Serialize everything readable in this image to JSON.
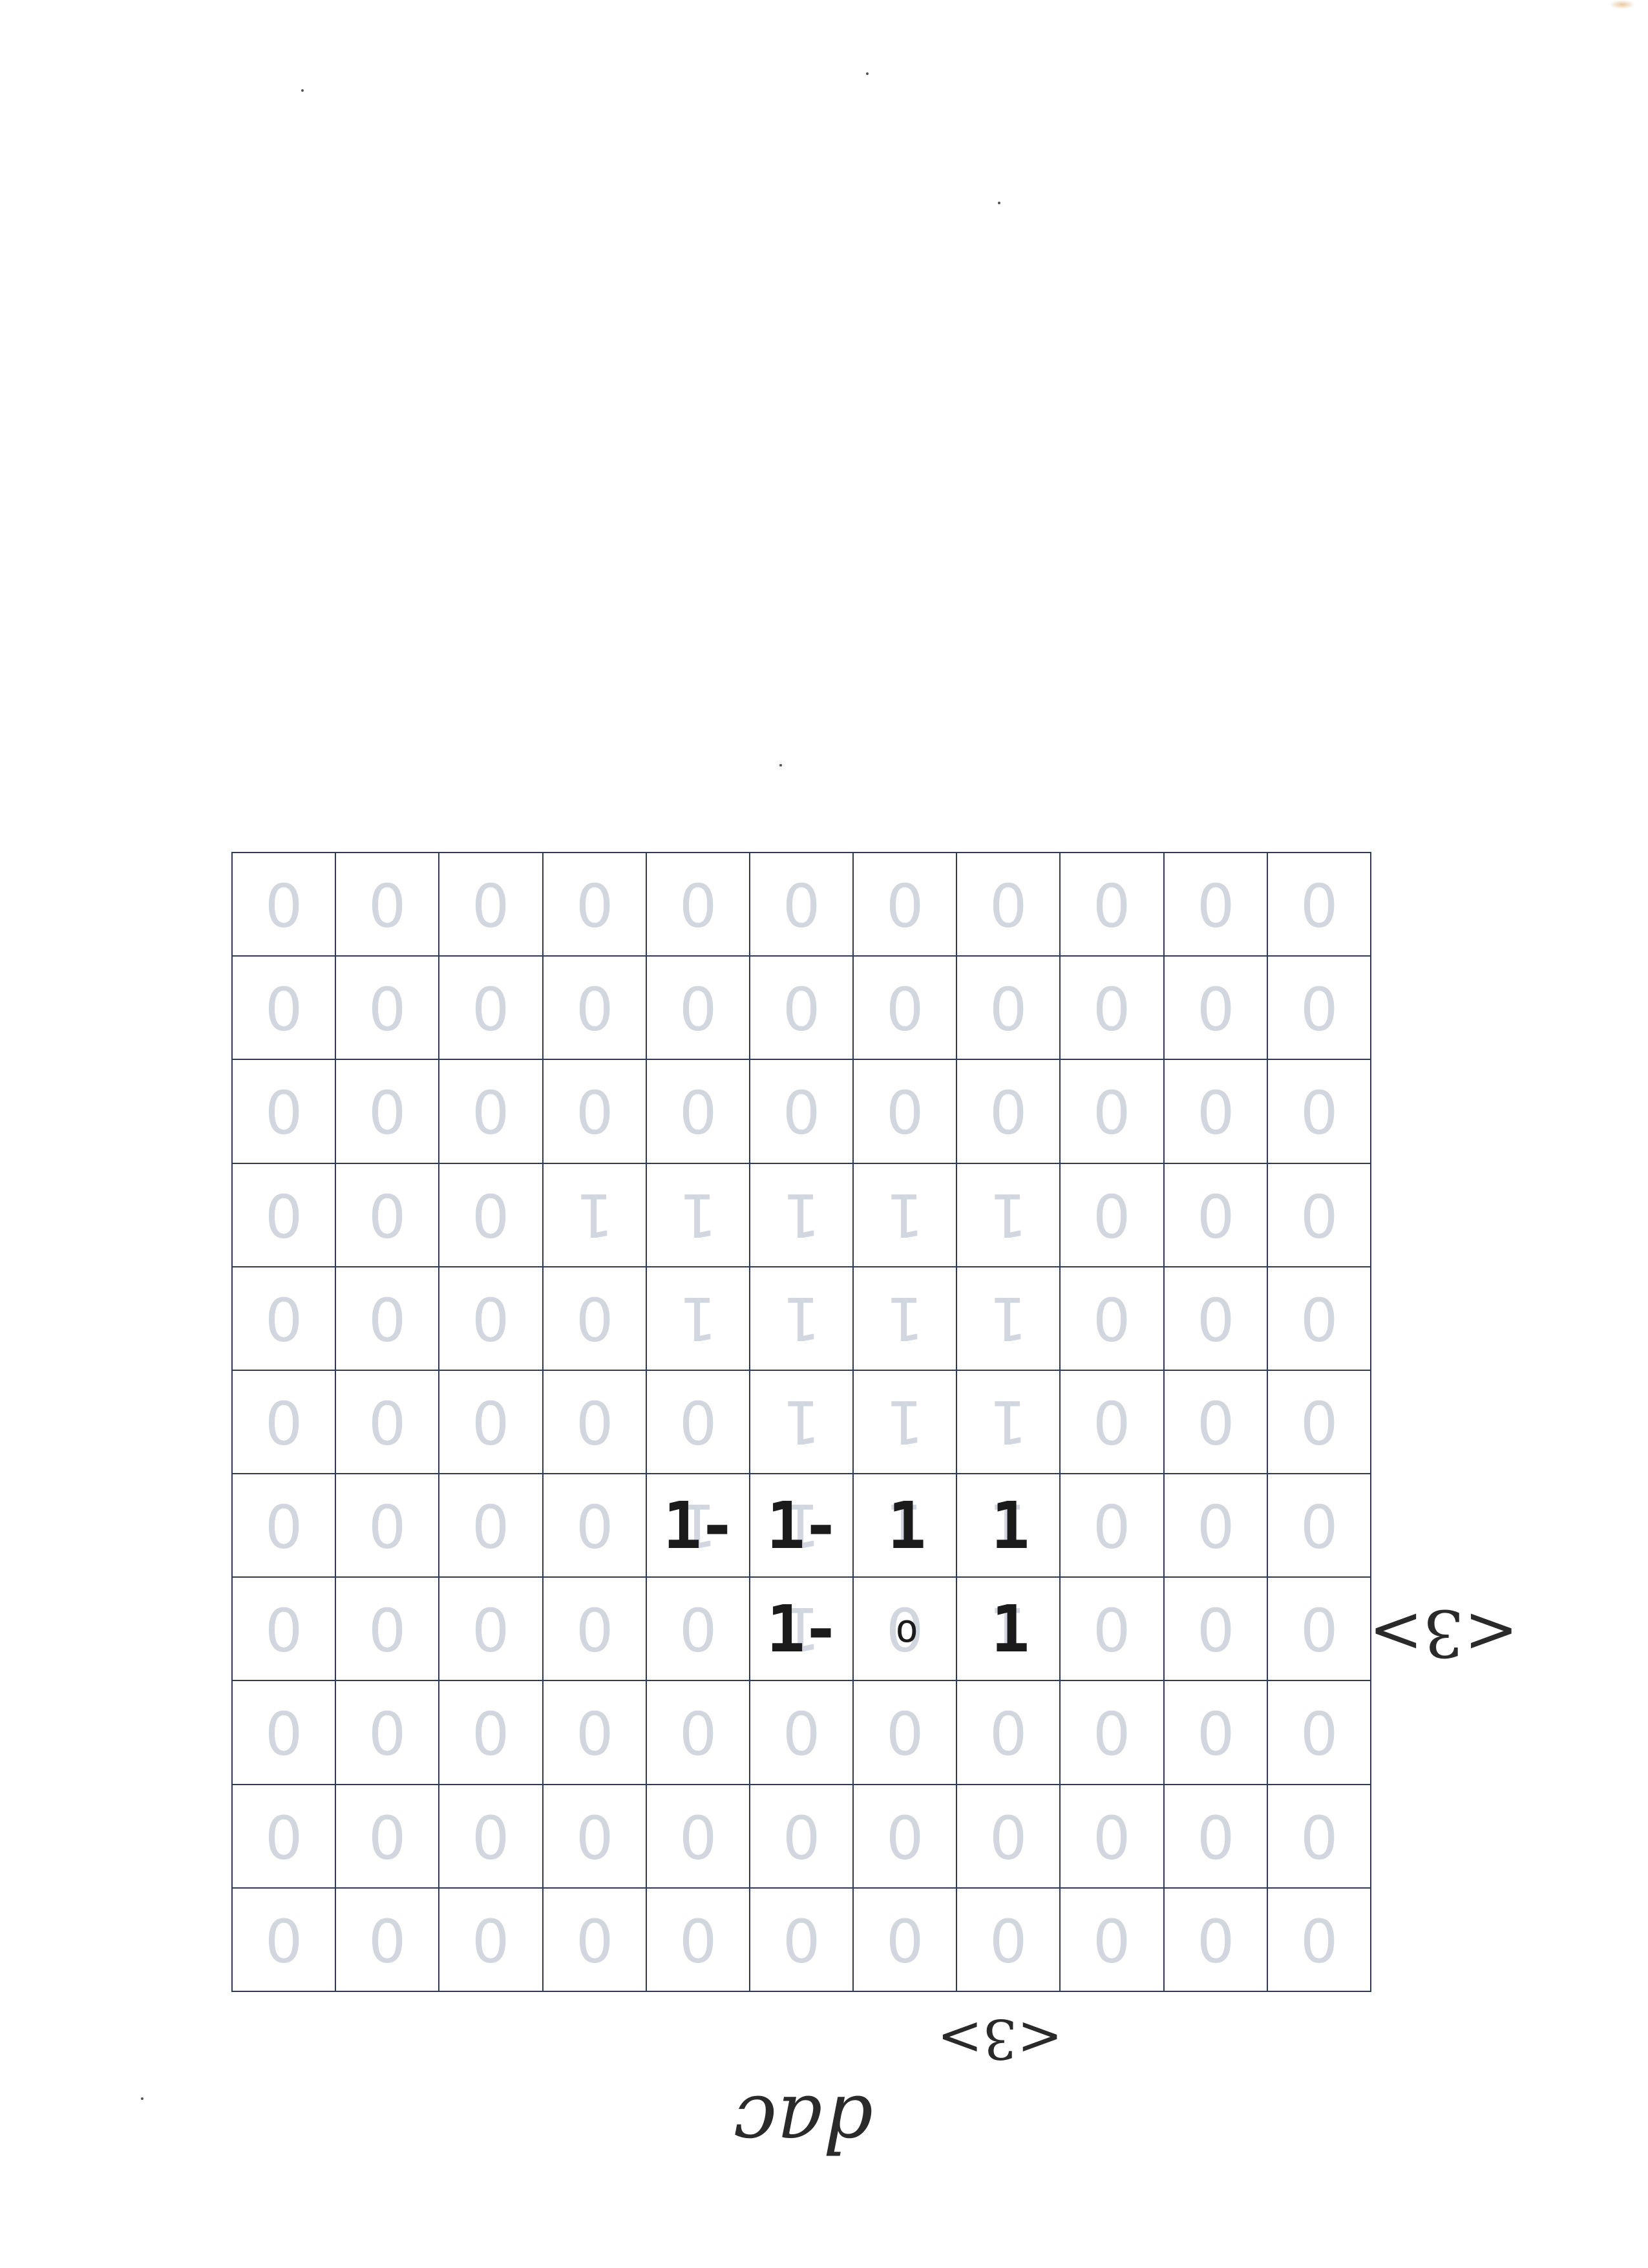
{
  "sheet": {
    "grid": [
      [
        "0",
        "0",
        "0",
        "0",
        "0",
        "0",
        "0",
        "0",
        "0",
        "0",
        "0"
      ],
      [
        "0",
        "0",
        "0",
        "0",
        "0",
        "0",
        "0",
        "0",
        "0",
        "0",
        "0"
      ],
      [
        "0",
        "0",
        "0",
        "0",
        "0",
        "0",
        "0",
        "0",
        "0",
        "0",
        "0"
      ],
      [
        "0",
        "0",
        "0",
        "1",
        "1",
        "1",
        "1",
        "1",
        "0",
        "0",
        "0"
      ],
      [
        "0",
        "0",
        "0",
        "0",
        "1",
        "1",
        "1",
        "1",
        "0",
        "0",
        "0"
      ],
      [
        "0",
        "0",
        "0",
        "0",
        "0",
        "1",
        "1",
        "1",
        "0",
        "0",
        "0"
      ],
      [
        "0",
        "0",
        "0",
        "0",
        "1",
        "1",
        "1",
        "1",
        "0",
        "0",
        "0"
      ],
      [
        "0",
        "0",
        "0",
        "0",
        "0",
        "1",
        "0",
        "1",
        "0",
        "0",
        "0"
      ],
      [
        "0",
        "0",
        "0",
        "0",
        "0",
        "0",
        "0",
        "0",
        "0",
        "0",
        "0"
      ],
      [
        "0",
        "0",
        "0",
        "0",
        "0",
        "0",
        "0",
        "0",
        "0",
        "0",
        "0"
      ],
      [
        "0",
        "0",
        "0",
        "0",
        "0",
        "0",
        "0",
        "0",
        "0",
        "0",
        "0"
      ]
    ],
    "handwritten": [
      {
        "row": 6,
        "col": 4,
        "text": "1-"
      },
      {
        "row": 6,
        "col": 5,
        "text": "1-"
      },
      {
        "row": 6,
        "col": 6,
        "text": "1"
      },
      {
        "row": 6,
        "col": 7,
        "text": "1"
      },
      {
        "row": 7,
        "col": 5,
        "text": "1-"
      },
      {
        "row": 7,
        "col": 6,
        "text": "o"
      },
      {
        "row": 7,
        "col": 7,
        "text": "1"
      }
    ],
    "row_label": "<3>",
    "column_label": "<3>",
    "signature": "dac"
  }
}
